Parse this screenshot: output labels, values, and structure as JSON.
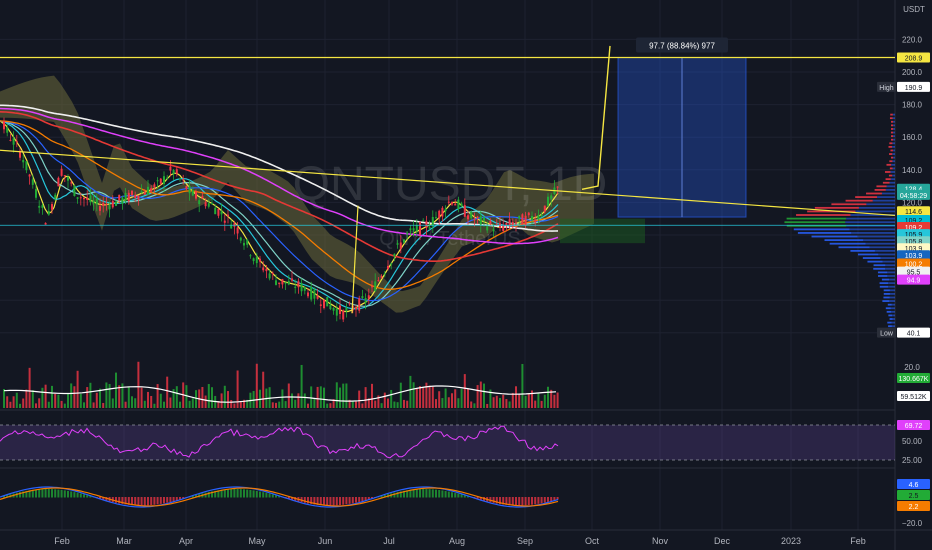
{
  "header": {
    "currency": "USDT"
  },
  "watermark": {
    "symbol": "QNTUSDT, 1D",
    "base_name": "QNT / TetherUS"
  },
  "measure_label": "97.7 (88.84%) 977",
  "x_axis": {
    "labels": [
      "Feb",
      "Mar",
      "Apr",
      "May",
      "Jun",
      "Jul",
      "Aug",
      "Sep",
      "Oct",
      "Nov",
      "Dec",
      "2023",
      "Feb"
    ]
  },
  "price_axis": {
    "ticks": [
      "220.0",
      "200.0",
      "180.0",
      "160.0",
      "140.0",
      "120.0",
      "100.0",
      "80.0",
      "60.0",
      "40.0"
    ]
  },
  "price_badges": [
    {
      "text": "208.9",
      "value": 208.9,
      "bg": "#f5e642",
      "fg": "#131722"
    },
    {
      "text": "190.9",
      "value": 190.9,
      "bg": "#ffffff",
      "fg": "#131722",
      "prefix": "High"
    },
    {
      "text": "128.4",
      "value": 128.4,
      "bg": "#26a69a",
      "fg": "#ffffff"
    },
    {
      "text": "04:58:29",
      "value": 124.6,
      "bg": "#26a69a",
      "fg": "#ffffff"
    },
    {
      "text": "114.6",
      "value": 114.6,
      "bg": "#f5e642",
      "fg": "#131722"
    },
    {
      "text": "109.2",
      "value": 109.2,
      "bg": "#00bcd4",
      "fg": "#131722"
    },
    {
      "text": "109.2",
      "value": 104.9,
      "bg": "#e53935",
      "fg": "#ffffff"
    },
    {
      "text": "105.9",
      "value": 100.5,
      "bg": "#26c6da",
      "fg": "#131722"
    },
    {
      "text": "105.8",
      "value": 96.2,
      "bg": "#7fd3c8",
      "fg": "#131722"
    },
    {
      "text": "103.9",
      "value": 91.9,
      "bg": "#fff9c4",
      "fg": "#131722"
    },
    {
      "text": "103.9",
      "value": 87.6,
      "bg": "#1565c0",
      "fg": "#ffffff"
    },
    {
      "text": "100.2",
      "value": 82.5,
      "bg": "#f57c00",
      "fg": "#ffffff"
    },
    {
      "text": "95.5",
      "value": 77.5,
      "bg": "#f0f0f0",
      "fg": "#131722"
    },
    {
      "text": "94.9",
      "value": 72.6,
      "bg": "#e040fb",
      "fg": "#ffffff"
    },
    {
      "text": "40.1",
      "value": 40.1,
      "bg": "#ffffff",
      "fg": "#131722",
      "prefix": "Low"
    }
  ],
  "volume_axis": {
    "tick": "20.0"
  },
  "volume_badges": [
    {
      "text": "130.667K",
      "bg": "#22ab36",
      "fg": "#ffffff",
      "pos": "top"
    },
    {
      "text": "59.512K",
      "bg": "#ffffff",
      "fg": "#131722",
      "pos": "bottom"
    }
  ],
  "rsi_axis": {
    "ticks": [
      "75.00",
      "50.00",
      "25.00"
    ]
  },
  "rsi_badge": {
    "text": "69.72",
    "bg": "#e040fb",
    "fg": "#ffffff"
  },
  "macd_axis": {
    "tick": "−20.0"
  },
  "macd_badges": [
    {
      "text": "4.6",
      "bg": "#2962ff",
      "fg": "#ffffff"
    },
    {
      "text": "2.5",
      "bg": "#22ab36",
      "fg": "#131722"
    },
    {
      "text": "2.2",
      "bg": "#f57c00",
      "fg": "#ffffff"
    }
  ],
  "colors": {
    "up": "#22ab36",
    "down": "#f23645",
    "accent": "#f5e642",
    "rsi": "#e040fb",
    "macd": "#2962ff",
    "signal": "#f57c00"
  },
  "chart_data": {
    "type": "candlestick",
    "title": "QNTUSDT, 1D",
    "ylim": [
      40,
      230
    ],
    "price_points": {
      "x": [
        "2022-01-10",
        "2022-01-20",
        "2022-02-01",
        "2022-02-08",
        "2022-02-15",
        "2022-02-25",
        "2022-03-05",
        "2022-03-15",
        "2022-03-25",
        "2022-04-01",
        "2022-04-10",
        "2022-04-20",
        "2022-05-01",
        "2022-05-10",
        "2022-05-20",
        "2022-06-01",
        "2022-06-10",
        "2022-06-20",
        "2022-07-01",
        "2022-07-10",
        "2022-07-20",
        "2022-08-01",
        "2022-08-10",
        "2022-08-20",
        "2022-09-01",
        "2022-09-10",
        "2022-09-20",
        "2022-09-29"
      ],
      "close": [
        170,
        150,
        108,
        140,
        125,
        118,
        120,
        125,
        130,
        140,
        125,
        118,
        105,
        85,
        72,
        68,
        60,
        52,
        60,
        80,
        100,
        108,
        122,
        110,
        104,
        108,
        112,
        128.4
      ]
    },
    "high": 190.9,
    "low": 40.1,
    "horizontal_level": 208.9,
    "measure": {
      "change": 97.7,
      "percent": 88.84,
      "bars": 977
    },
    "rsi_last": 69.72,
    "macd_last": [
      4.6,
      2.5,
      2.2
    ],
    "volume_last": [
      "130.667K",
      "59.512K"
    ]
  }
}
